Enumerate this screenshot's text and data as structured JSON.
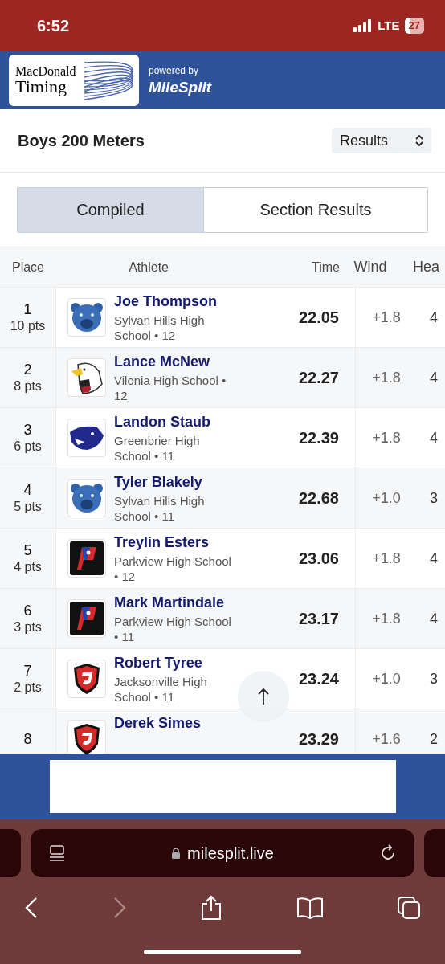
{
  "status_bar": {
    "time": "6:52",
    "network": "LTE",
    "battery": "27"
  },
  "header": {
    "logo_line1": "MacDonald",
    "logo_line2": "Timing",
    "powered_by": "powered by",
    "brand": "MileSplit"
  },
  "event": {
    "title": "Boys 200 Meters",
    "view_select": "Results"
  },
  "tabs": [
    {
      "label": "Compiled",
      "selected": true
    },
    {
      "label": "Section Results",
      "selected": false
    }
  ],
  "table": {
    "columns": [
      "Place",
      "Athlete",
      "Time",
      "Wind",
      "Hea"
    ],
    "rows": [
      {
        "place": "1",
        "points": "10 pts",
        "kind": "bear",
        "name": "Joe Thompson",
        "school": "Sylvan Hills High School • 12",
        "time": "22.05",
        "wind": "+1.8",
        "heat": "4"
      },
      {
        "place": "2",
        "points": "8 pts",
        "kind": "eagle",
        "name": "Lance McNew",
        "school": "Vilonia High School • 12",
        "time": "22.27",
        "wind": "+1.8",
        "heat": "4"
      },
      {
        "place": "3",
        "points": "6 pts",
        "kind": "panther",
        "name": "Landon Staub",
        "school": "Greenbrier High School • 11",
        "time": "22.39",
        "wind": "+1.8",
        "heat": "4"
      },
      {
        "place": "4",
        "points": "5 pts",
        "kind": "bear",
        "name": "Tyler Blakely",
        "school": "Sylvan Hills High School • 11",
        "time": "22.68",
        "wind": "+1.0",
        "heat": "3"
      },
      {
        "place": "5",
        "points": "4 pts",
        "kind": "flag",
        "name": "Treylin Esters",
        "school": "Parkview High School • 12",
        "time": "23.06",
        "wind": "+1.8",
        "heat": "4"
      },
      {
        "place": "6",
        "points": "3 pts",
        "kind": "flag",
        "name": "Mark Martindale",
        "school": "Parkview High School • 11",
        "time": "23.17",
        "wind": "+1.8",
        "heat": "4"
      },
      {
        "place": "7",
        "points": "2 pts",
        "kind": "shield",
        "name": "Robert Tyree",
        "school": "Jacksonville High School • 11",
        "time": "23.24",
        "wind": "+1.0",
        "heat": "3"
      },
      {
        "place": "8",
        "kind": "shield",
        "name": "Derek Simes",
        "time": "23.29",
        "wind": "+1.6",
        "heat": "2"
      }
    ]
  },
  "browser": {
    "url": "milesplit.live"
  }
}
